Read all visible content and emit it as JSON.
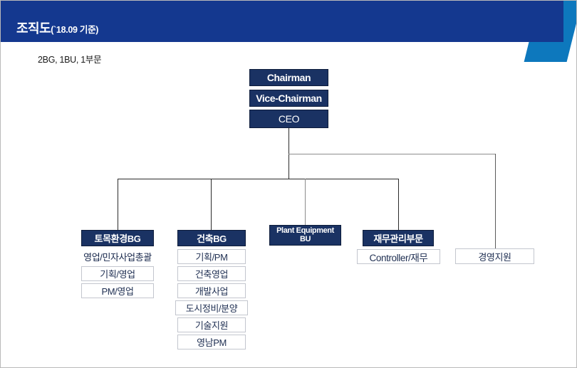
{
  "header": {
    "title_main": "조직도",
    "title_sub": "(`18.09 기준)",
    "accent_color": "#0d78bd",
    "bar_color": "#14388f"
  },
  "subtitle": "2BG, 1BU, 1부문",
  "colors": {
    "navy_box": "#1a3263",
    "plain_border": "#c3c6ce",
    "text_navy": "#1f2f52",
    "line": "#2b2b2b",
    "line_grey": "#8c8c8c"
  },
  "executive": [
    {
      "label": "Chairman"
    },
    {
      "label": "Vice-Chairman"
    },
    {
      "label": "CEO"
    }
  ],
  "divisions": [
    {
      "name": "토목환경BG",
      "children": [
        {
          "label": "영업/민자사업총괄",
          "style": "bare"
        },
        {
          "label": "기획/영업",
          "style": "plain"
        },
        {
          "label": "PM/영업",
          "style": "plain"
        }
      ]
    },
    {
      "name": "건축BG",
      "children": [
        {
          "label": "기획/PM",
          "style": "plain"
        },
        {
          "label": "건축영업",
          "style": "plain"
        },
        {
          "label": "개발사업",
          "style": "plain"
        },
        {
          "label": "도시정비/분양",
          "style": "plain"
        },
        {
          "label": "기술지원",
          "style": "plain"
        },
        {
          "label": "영남PM",
          "style": "plain"
        }
      ]
    },
    {
      "name": "Plant Equipment\nBU",
      "name_line1": "Plant Equipment",
      "name_line2": "BU",
      "children": []
    },
    {
      "name": "재무관리부문",
      "children": [
        {
          "label": "Controller/재무",
          "style": "plain"
        }
      ]
    }
  ],
  "support": {
    "label": "경영지원"
  }
}
